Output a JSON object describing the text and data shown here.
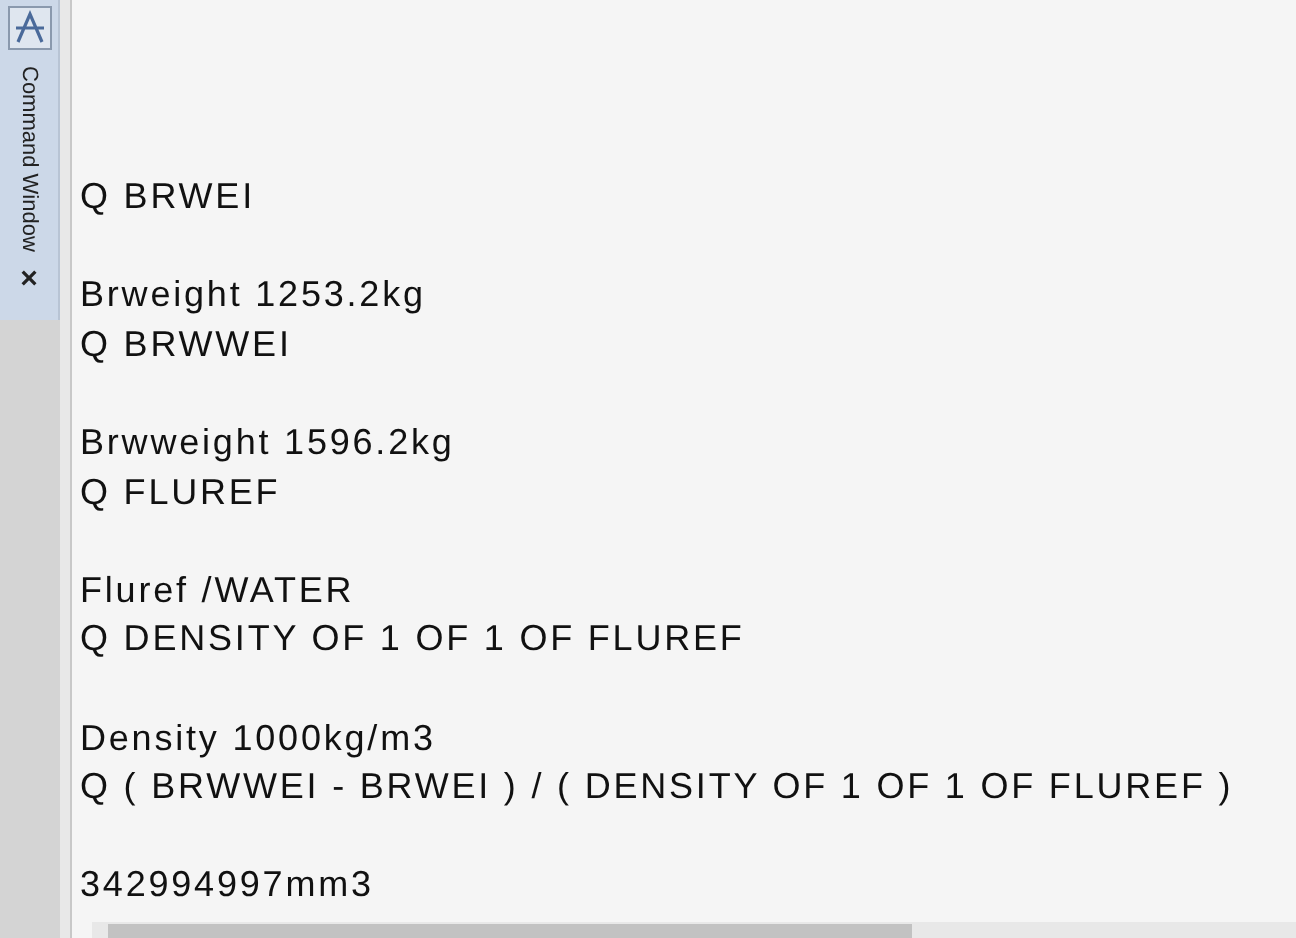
{
  "panel": {
    "title": "Command Window",
    "close": "×"
  },
  "entries": [
    {
      "command": "Q BRWEI",
      "output": "Brweight 1253.2kg"
    },
    {
      "command": "Q BRWWEI",
      "output": "Brwweight 1596.2kg"
    },
    {
      "command": "Q FLUREF",
      "output": "Fluref /WATER"
    },
    {
      "command": "Q DENSITY OF 1 OF 1 OF FLUREF",
      "output": "Density 1000kg/m3"
    },
    {
      "command": "Q ( BRWWEI - BRWEI ) / ( DENSITY OF 1 OF 1 OF FLUREF )",
      "output": "342994997mm3"
    }
  ]
}
